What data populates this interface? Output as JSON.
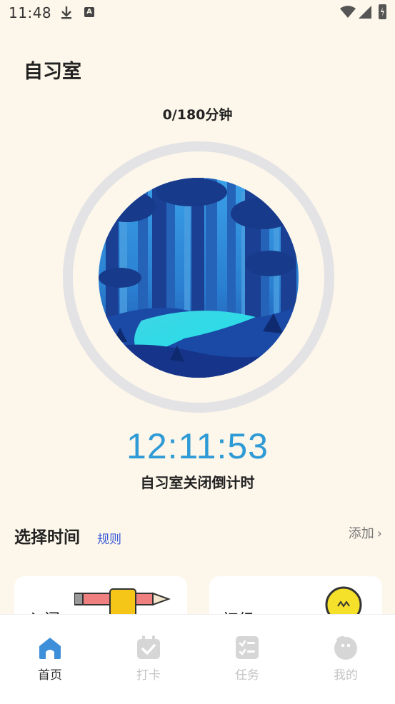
{
  "status_bar": {
    "time": "11:48"
  },
  "page": {
    "title": "自习室"
  },
  "progress": {
    "text": "0/180分钟",
    "current_minutes": 0,
    "total_minutes": 180
  },
  "countdown": {
    "time": "12:11:53",
    "label": "自习室关闭倒计时"
  },
  "select_time": {
    "title": "选择时间",
    "rules_link": "规则",
    "add_label": "添加"
  },
  "cards": [
    {
      "label": "入门"
    },
    {
      "label": "初级"
    }
  ],
  "tabs": [
    {
      "label": "首页",
      "icon": "home-icon",
      "active": true
    },
    {
      "label": "打卡",
      "icon": "calendar-check-icon",
      "active": false
    },
    {
      "label": "任务",
      "icon": "task-list-icon",
      "active": false
    },
    {
      "label": "我的",
      "icon": "profile-icon",
      "active": false
    }
  ],
  "colors": {
    "accent": "#2f9bd6",
    "link": "#3b5bd9",
    "background": "#fdf6ea",
    "tab_active": "#3d8fd9",
    "tab_inactive": "#d6d6d6"
  }
}
